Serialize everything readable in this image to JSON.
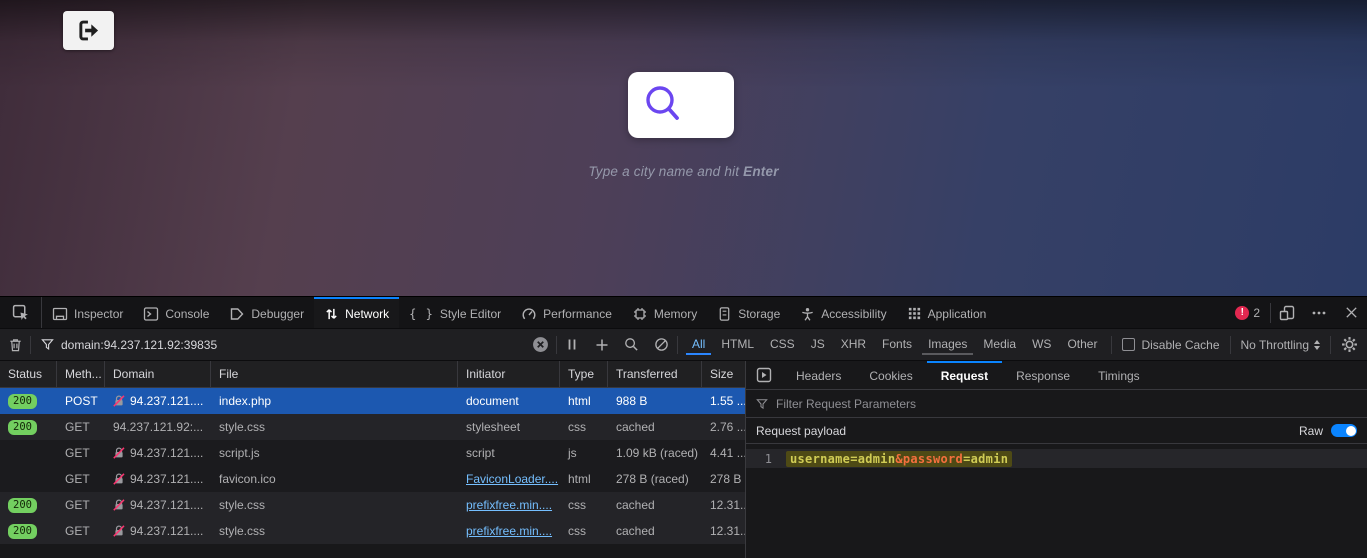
{
  "page": {
    "hint_prefix": "Type a city name and hit ",
    "hint_bold": "Enter",
    "search_icon_color": "#6b46f0"
  },
  "devtools": {
    "toolbox_tabs": [
      {
        "label": "Inspector",
        "icon": "inspector-icon"
      },
      {
        "label": "Console",
        "icon": "console-icon"
      },
      {
        "label": "Debugger",
        "icon": "debugger-icon"
      },
      {
        "label": "Network",
        "icon": "network-icon"
      },
      {
        "label": "Style Editor",
        "icon": "style-editor-icon"
      },
      {
        "label": "Performance",
        "icon": "performance-icon"
      },
      {
        "label": "Memory",
        "icon": "memory-icon"
      },
      {
        "label": "Storage",
        "icon": "storage-icon"
      },
      {
        "label": "Accessibility",
        "icon": "accessibility-icon"
      },
      {
        "label": "Application",
        "icon": "application-icon"
      }
    ],
    "active_toolbox_tab": "Network",
    "error_badge_count": "2",
    "accent_color": "#0a84ff",
    "netbar": {
      "filter_value": "domain:94.237.121.92:39835",
      "type_filters": [
        "All",
        "HTML",
        "CSS",
        "JS",
        "XHR",
        "Fonts",
        "Images",
        "Media",
        "WS",
        "Other"
      ],
      "active_type_filter": "All",
      "hovered_type_filter": "Images",
      "disable_cache_label": "Disable Cache",
      "disable_cache_checked": false,
      "throttling_value": "No Throttling"
    },
    "table": {
      "columns": [
        "Status",
        "Meth...",
        "Domain",
        "File",
        "Initiator",
        "Type",
        "Transferred",
        "Size"
      ],
      "status_badge_value": "200",
      "rows": [
        {
          "status": "200",
          "method": "POST",
          "domain": "94.237.121....",
          "insecure_icon": true,
          "file": "index.php",
          "initiator": "document",
          "initiator_link": false,
          "type": "html",
          "transferred": "988 B",
          "size": "1.55 ...",
          "selected": true,
          "shade": "dark"
        },
        {
          "status": "200",
          "method": "GET",
          "domain": "94.237.121.92:...",
          "insecure_icon": false,
          "file": "style.css",
          "initiator": "stylesheet",
          "initiator_link": false,
          "type": "css",
          "transferred": "cached",
          "size": "2.76 ...",
          "selected": false,
          "shade": "light"
        },
        {
          "status": "",
          "method": "GET",
          "domain": "94.237.121....",
          "insecure_icon": true,
          "file": "script.js",
          "initiator": "script",
          "initiator_link": false,
          "type": "js",
          "transferred": "1.09 kB (raced)",
          "size": "4.41 ...",
          "selected": false,
          "shade": "dark"
        },
        {
          "status": "",
          "method": "GET",
          "domain": "94.237.121....",
          "insecure_icon": true,
          "file": "favicon.ico",
          "initiator": "FaviconLoader....",
          "initiator_link": true,
          "type": "html",
          "transferred": "278 B (raced)",
          "size": "278 B",
          "selected": false,
          "shade": "dark"
        },
        {
          "status": "200",
          "method": "GET",
          "domain": "94.237.121....",
          "insecure_icon": true,
          "file": "style.css",
          "initiator": "prefixfree.min....",
          "initiator_link": true,
          "type": "css",
          "transferred": "cached",
          "size": "12.31...",
          "selected": false,
          "shade": "light"
        },
        {
          "status": "200",
          "method": "GET",
          "domain": "94.237.121....",
          "insecure_icon": true,
          "file": "style.css",
          "initiator": "prefixfree.min....",
          "initiator_link": true,
          "type": "css",
          "transferred": "cached",
          "size": "12.31...",
          "selected": false,
          "shade": "light"
        }
      ],
      "status_badge_color": "#73cf60",
      "selected_row_color": "#1c58b0"
    },
    "sidepanel": {
      "tabs": [
        "Headers",
        "Cookies",
        "Request",
        "Response",
        "Timings"
      ],
      "active_tab": "Request",
      "filter_placeholder": "Filter Request Parameters",
      "payload_label": "Request payload",
      "raw_label": "Raw",
      "raw_enabled": true,
      "code_line": {
        "number": "1",
        "highlight_color": "#4e4a15",
        "segments": [
          {
            "text": "username=admin",
            "color": "#d0cc55"
          },
          {
            "text": "&password",
            "color": "#f4703e"
          },
          {
            "text": "=admin",
            "color": "#d0cc55"
          }
        ]
      }
    }
  }
}
